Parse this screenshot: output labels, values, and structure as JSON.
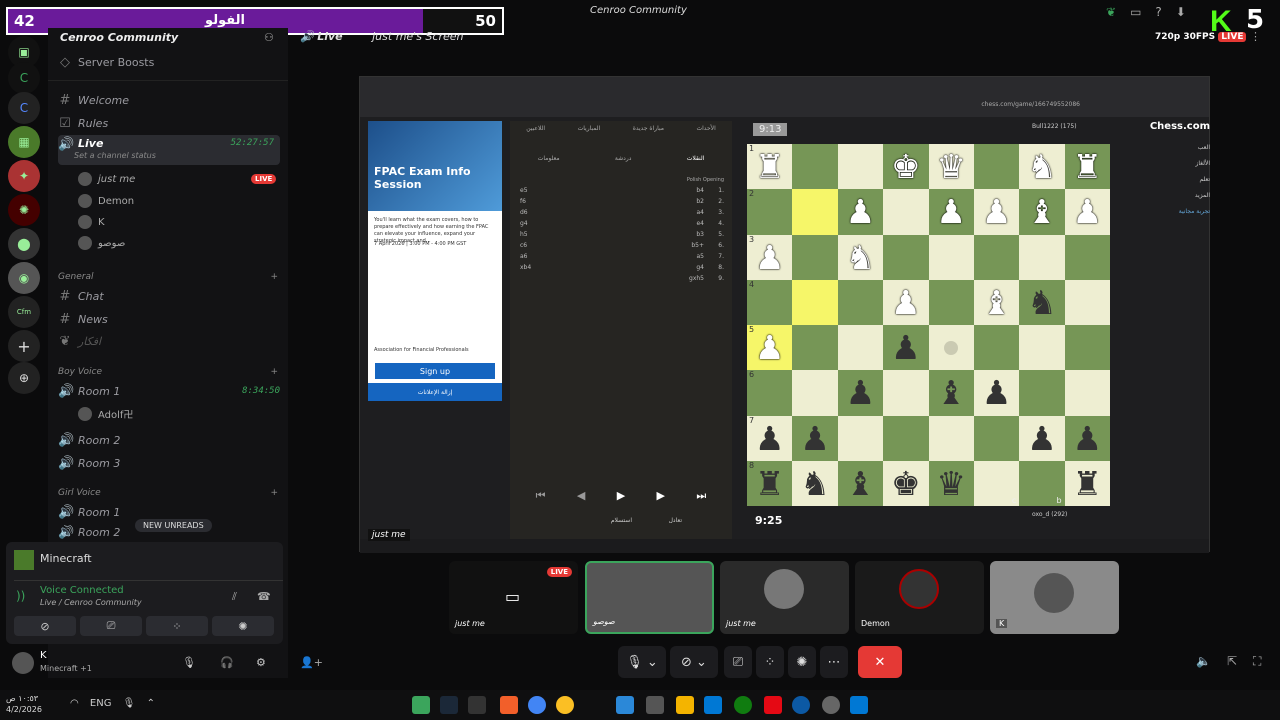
{
  "overlay": {
    "left_count": "42",
    "title": "الفولو",
    "right_count": "50",
    "fill_fraction": 0.84
  },
  "window_title": "Cenroo Community",
  "stream_header": {
    "channel": "Live",
    "user": "just me's Screen"
  },
  "kick": {
    "logo": "K",
    "number": "5",
    "quality": "720p 30FPS",
    "live": "LIVE"
  },
  "server": {
    "name": "Cenroo Community",
    "boosts": "Server Boosts"
  },
  "channels": {
    "welcome": "Welcome",
    "rules": "Rules",
    "live": {
      "name": "Live",
      "time": "52:27:57",
      "status": "Set a channel status"
    },
    "live_users": [
      {
        "name": "just me",
        "badge": "LIVE"
      },
      {
        "name": "Demon"
      },
      {
        "name": "K"
      },
      {
        "name": "صوصو"
      }
    ],
    "general_cat": "General",
    "chat": "Chat",
    "news": "News",
    "afkar": "افكار",
    "boy_cat": "Boy Voice",
    "room1": {
      "name": "Room 1",
      "time": "8:34:50",
      "user": "Adolf卍"
    },
    "room2": "Room 2",
    "room3": "Room 3",
    "girl_cat": "Girl Voice",
    "groom1": "Room 1",
    "groom2": "Room 2",
    "new_unreads": "NEW UNREADS"
  },
  "game_activity": "Minecraft",
  "voice": {
    "status": "Voice Connected",
    "location": "Live / Cenroo Community"
  },
  "user": {
    "name": "K",
    "activity": "Minecraft +1"
  },
  "share": {
    "url": "chess.com/game/166749552086",
    "ad": {
      "title": "FPAC Exam Info Session",
      "text": "You'll learn what the exam covers, how to prepare effectively and how earning the FPAC can elevate your influence, expand your strategic impact and...",
      "date": "7 April 2026 | 3:00 PM - 4:00 PM GST",
      "assoc": "Association for Financial Professionals",
      "signup": "Sign up",
      "remove": "إزالة الإعلانات"
    },
    "tabs": [
      "الأحداث",
      "مباراة جديدة",
      "المباريات",
      "اللاعبين"
    ],
    "subtabs": [
      "النقلات",
      "دردشة",
      "معلومات"
    ],
    "opening": "Polish Opening",
    "moves": [
      [
        "1.",
        "b4",
        "e5"
      ],
      [
        "2.",
        "b2",
        "f6"
      ],
      [
        "3.",
        "a4",
        "d6"
      ],
      [
        "4.",
        "e4",
        "g4"
      ],
      [
        "5.",
        "b3",
        "h5"
      ],
      [
        "6.",
        "b5+",
        "c6"
      ],
      [
        "7.",
        "a5",
        "a6"
      ],
      [
        "8.",
        "g4",
        "xb4"
      ],
      [
        "9.",
        "gxh5",
        ""
      ]
    ],
    "timer_top": "9:13",
    "timer_bottom": "9:25",
    "player_top": "Bull1222 (175)",
    "player_bottom": "oxo_d (292)",
    "resign": "استسلام",
    "draw": "تعادل",
    "chess_logo": "Chess.com",
    "side_menu": [
      "العب",
      "الألغاز",
      "تعلم",
      "المزيد",
      "تجربة مجانية"
    ],
    "board_files": [
      "",
      "",
      "",
      "",
      "",
      "c",
      "b",
      ""
    ],
    "board": [
      [
        "wR",
        "",
        "",
        "wK",
        "wQ",
        "",
        "wN",
        "wR"
      ],
      [
        "",
        "",
        "wP",
        "",
        "wP",
        "wP",
        "wB",
        "wP"
      ],
      [
        "wP",
        "",
        "wN",
        "",
        "",
        "",
        "",
        ""
      ],
      [
        "",
        "",
        "",
        "wP",
        "",
        "wB",
        "bN",
        ""
      ],
      [
        "wP",
        "",
        "",
        "bP",
        "dot",
        "",
        "",
        ""
      ],
      [
        "",
        "",
        "bP",
        "",
        "bB",
        "bP",
        "",
        ""
      ],
      [
        "bP",
        "bP",
        "",
        "",
        "",
        "",
        "bP",
        "bP"
      ],
      [
        "bR",
        "bN",
        "bB",
        "bK",
        "bQ",
        "",
        "",
        "bR"
      ]
    ],
    "ranks": [
      "1",
      "2",
      "3",
      "4",
      "5",
      "6",
      "7",
      "8"
    ],
    "sharer_label": "just me"
  },
  "tiles": [
    {
      "name": "just me",
      "badge": "LIVE"
    },
    {
      "name": "صوصو"
    },
    {
      "name": "just me"
    },
    {
      "name": "Demon"
    },
    {
      "name": "K"
    }
  ],
  "taskbar": {
    "time": "١٠:٥٣ ص",
    "date": "4/2/2026",
    "lang": "ENG"
  },
  "colors": {
    "discord_green": "#3ba55c",
    "live_red": "#e53935",
    "board_light": "#eeeed2",
    "board_dark": "#769656",
    "kick_green": "#53fc18"
  }
}
